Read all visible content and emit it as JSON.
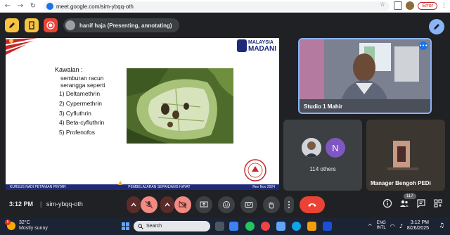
{
  "browser": {
    "url": "meet.google.com/sim-ybqq-oth",
    "error_chip": "Error"
  },
  "topbar": {
    "presenter_label": "hanif haja (Presenting, annotating)"
  },
  "slide": {
    "brand_line1": "MALAYSIA",
    "brand_line2": "MADANI",
    "heading": "Kawalan :",
    "subheading_line1": "semburan racun",
    "subheading_line2": "serangga seperti",
    "pesticides": [
      "1)   Deltamethrin",
      "2)   Cypermethrin",
      "3)   Cyfluthrin",
      "4)   Beta-cyfluthrin",
      "5)   Profenofos"
    ],
    "footer_left": "KURSUS NADI PETANIAN PINTAR",
    "footer_center": "PEMBELAJARAN SEPANJANG HAYAT",
    "footer_right": "Rev Nov 2024"
  },
  "tiles": {
    "main_name": "Studio 1 Mahir",
    "others_initial": "N",
    "others_count": "114 others",
    "manager_name": "Manager Bengoh PEDi"
  },
  "controls": {
    "time": "3:12 PM",
    "meeting_code": "sim-ybqq-oth",
    "people_badge": "117"
  },
  "taskbar": {
    "temperature": "32°C",
    "condition": "Mostly sunny",
    "weather_badge": "5",
    "search_placeholder": "Search",
    "lang1": "ENG",
    "lang2": "INTL",
    "clock_time": "3:12 PM",
    "clock_date": "8/26/2025"
  },
  "colors": {
    "meet_bg": "#202124",
    "hangup": "#ea4335",
    "active_tile_border": "#8ab4f8",
    "slide_footer": "#1e2a78"
  }
}
